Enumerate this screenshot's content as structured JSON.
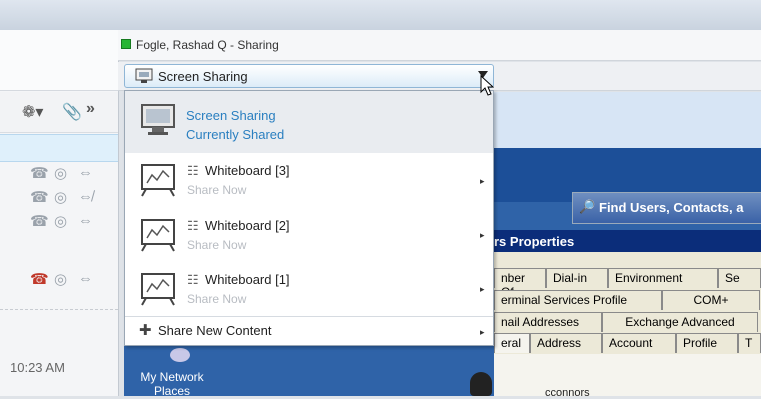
{
  "window": {
    "title": "Fogle, Rashad Q - Sharing",
    "status_color": "#27b534"
  },
  "share_dropdown": {
    "selected": "Screen Sharing",
    "items": [
      {
        "title": "Screen Sharing",
        "subtitle": "Currently Shared",
        "icon": "monitor-share-icon",
        "current": true
      },
      {
        "title": "Whiteboard [3]",
        "subtitle": "Share Now",
        "icon": "whiteboard-icon"
      },
      {
        "title": "Whiteboard [2]",
        "subtitle": "Share Now",
        "icon": "whiteboard-icon"
      },
      {
        "title": "Whiteboard [1]",
        "subtitle": "Share Now",
        "icon": "whiteboard-icon"
      }
    ],
    "new_content": "Share New Content"
  },
  "conversation": {
    "toolbar_overflow": "»",
    "timestamp": "10:23 AM"
  },
  "remote_desktop": {
    "find_window_title": "Find Users, Contacts, a",
    "properties_title": "rs Properties",
    "tabs_row1": [
      "nber Of",
      "Dial-in",
      "Environment",
      "Se"
    ],
    "tabs_row2": [
      "erminal Services Profile",
      "COM+",
      ""
    ],
    "tabs_row3": [
      "nail Addresses",
      "Exchange Advanced",
      ""
    ],
    "tabs_row4": [
      "eral",
      "Address",
      "Account",
      "Profile",
      "T"
    ],
    "user": "cconnors",
    "desktop_icon_label": "My Network Places"
  },
  "colors": {
    "accent_text": "#2a7fc0",
    "disabled_text": "#b8bcc2",
    "title_bar": "#0b2d7a"
  }
}
